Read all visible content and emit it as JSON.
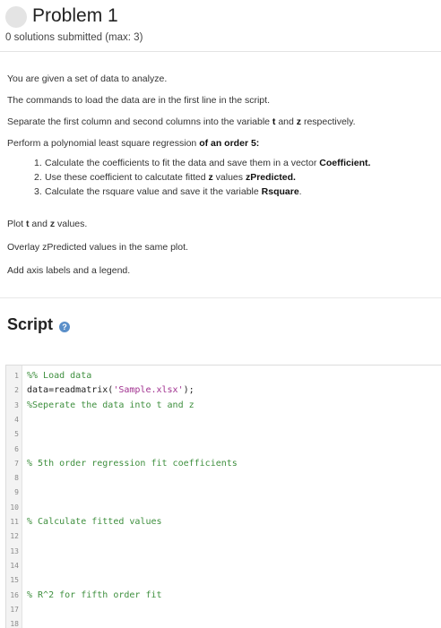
{
  "header": {
    "title": "Problem 1",
    "subtitle": "0 solutions submitted (max: 3)"
  },
  "description": {
    "line1": "You are given a set of data to analyze.",
    "line2": "The commands to load the data are in the first line in the script.",
    "line3_pre": "Separate the first column and second columns into the variable ",
    "line3_t": "t",
    "line3_and": " and ",
    "line3_z": "z",
    "line3_post": " respectively.",
    "line4_pre": "Perform a polynomial least square regression ",
    "line4_bold": "of an order 5:",
    "steps": [
      {
        "num": "1.",
        "pre": "Calculate the coefficients to fit the data and save them in a vector ",
        "bold": "Coefficient.",
        "mid": "",
        "bold2": "",
        "post": ""
      },
      {
        "num": "2.",
        "pre": "Use these coefficient to calcutate fitted ",
        "bold": "z",
        "mid": " values ",
        "bold2": "zPredicted.",
        "post": ""
      },
      {
        "num": "3.",
        "pre": "Calculate the rsquare value and save it the variable ",
        "bold": "Rsquare",
        "mid": "",
        "bold2": "",
        "post": "."
      }
    ],
    "plot_pre": "Plot ",
    "plot_t": "t",
    "plot_and": " and ",
    "plot_z": "z",
    "plot_post": " values.",
    "overlay": "Overlay zPredicted values in the same plot.",
    "axis": "Add axis labels and a legend."
  },
  "script": {
    "heading": "Script",
    "help_icon": "?",
    "lines": [
      {
        "n": "1",
        "text": "%% Load data",
        "kind": "comment"
      },
      {
        "n": "2",
        "text_pre": "data=readmatrix(",
        "text_str": "'Sample.xlsx'",
        "text_post": ");",
        "kind": "mixed"
      },
      {
        "n": "3",
        "text": "%Seperate the data into t and z",
        "kind": "comment"
      },
      {
        "n": "4",
        "text": "",
        "kind": "normal"
      },
      {
        "n": "5",
        "text": "",
        "kind": "normal"
      },
      {
        "n": "6",
        "text": "",
        "kind": "normal"
      },
      {
        "n": "7",
        "text": "% 5th order regression fit coefficients",
        "kind": "comment"
      },
      {
        "n": "8",
        "text": "",
        "kind": "normal"
      },
      {
        "n": "9",
        "text": "",
        "kind": "normal"
      },
      {
        "n": "10",
        "text": "",
        "kind": "normal"
      },
      {
        "n": "11",
        "text": "% Calculate fitted values",
        "kind": "comment"
      },
      {
        "n": "12",
        "text": "",
        "kind": "normal"
      },
      {
        "n": "13",
        "text": "",
        "kind": "normal"
      },
      {
        "n": "14",
        "text": "",
        "kind": "normal"
      },
      {
        "n": "15",
        "text": "",
        "kind": "normal"
      },
      {
        "n": "16",
        "text": "% R^2 for fifth order fit",
        "kind": "comment"
      },
      {
        "n": "17",
        "text": "",
        "kind": "normal"
      },
      {
        "n": "18",
        "text": "",
        "kind": "normal"
      }
    ]
  }
}
